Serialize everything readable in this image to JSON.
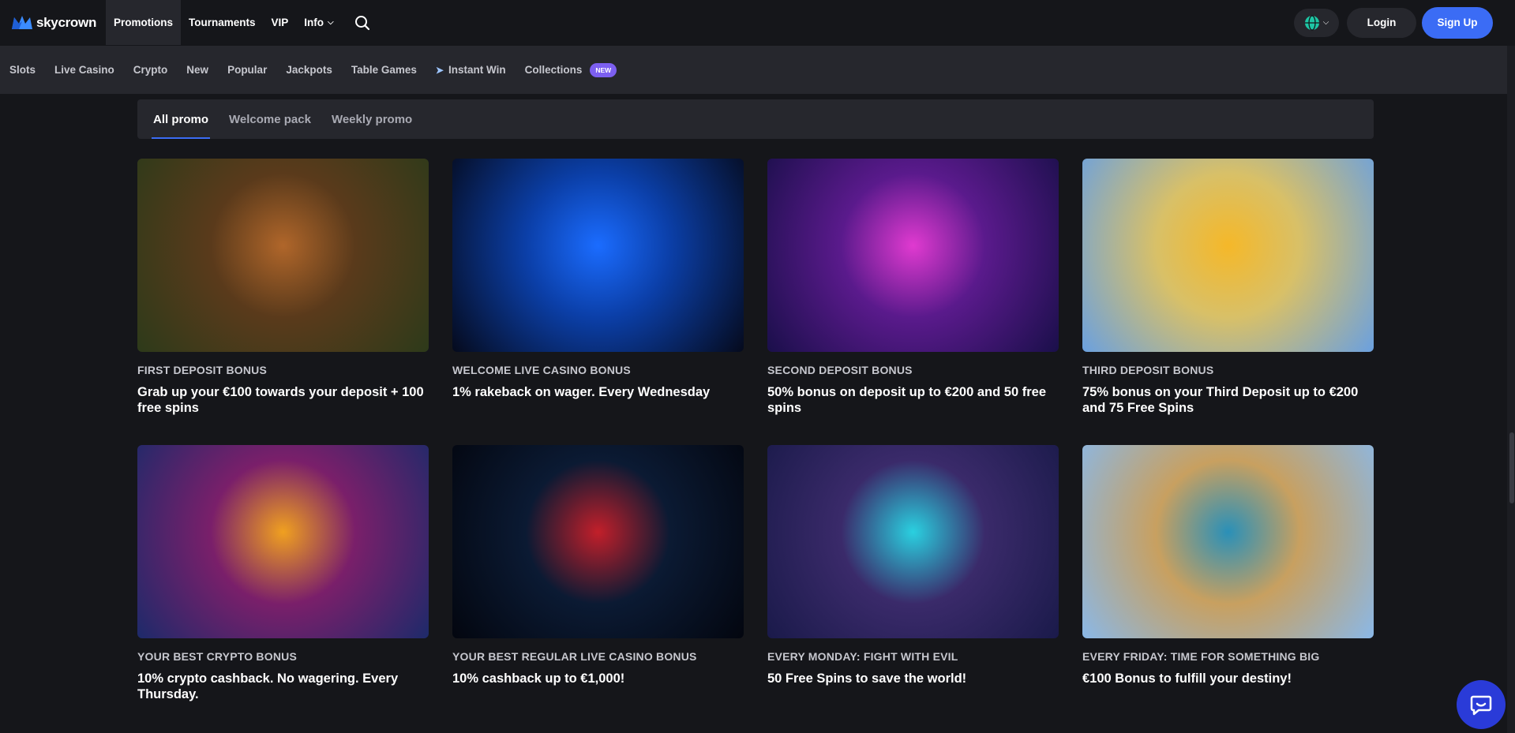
{
  "header": {
    "logo_text": "skycrown",
    "nav": [
      {
        "label": "Promotions",
        "active": true
      },
      {
        "label": "Tournaments"
      },
      {
        "label": "VIP"
      },
      {
        "label": "Info",
        "dropdown": true
      }
    ],
    "login_label": "Login",
    "signup_label": "Sign Up"
  },
  "categories": [
    {
      "label": "Slots"
    },
    {
      "label": "Live Casino"
    },
    {
      "label": "Crypto"
    },
    {
      "label": "New"
    },
    {
      "label": "Popular"
    },
    {
      "label": "Jackpots"
    },
    {
      "label": "Table Games"
    },
    {
      "label": "Instant Win",
      "icon": "rocket-icon"
    },
    {
      "label": "Collections",
      "badge": "NEW"
    }
  ],
  "tabs": [
    {
      "label": "All promo",
      "active": true
    },
    {
      "label": "Welcome pack"
    },
    {
      "label": "Weekly promo"
    }
  ],
  "promos": [
    {
      "caption": "FIRST DEPOSIT BONUS",
      "title": "Grab up your €100 towards your deposit + 100 free spins",
      "bg": [
        "#2d3a1a",
        "#5a3a1b",
        "#b0662a"
      ]
    },
    {
      "caption": "WELCOME LIVE CASINO BONUS",
      "title": "1% rakeback on wager. Every Wednesday",
      "bg": [
        "#050a1c",
        "#0b3fa8",
        "#1b6cff"
      ]
    },
    {
      "caption": "SECOND DEPOSIT BONUS",
      "title": "50% bonus on deposit up to €200 and 50 free spins",
      "bg": [
        "#1a0f4a",
        "#5a1a8c",
        "#e03ad0"
      ]
    },
    {
      "caption": "THIRD DEPOSIT BONUS",
      "title": "75% bonus on your Third Deposit up to €200 and 75 Free Spins",
      "bg": [
        "#6aa0e0",
        "#d8c068",
        "#f5b829"
      ]
    },
    {
      "caption": "YOUR BEST CRYPTO BONUS",
      "title": "10% crypto cashback. No wagering. Every Thursday.",
      "bg": [
        "#1d2a6a",
        "#7a1f6a",
        "#f0a020"
      ]
    },
    {
      "caption": "YOUR BEST REGULAR LIVE CASINO BONUS",
      "title": "10% cashback up to €1,000!",
      "bg": [
        "#03060f",
        "#0b1a33",
        "#c21f2a"
      ]
    },
    {
      "caption": "EVERY MONDAY: FIGHT WITH EVIL",
      "title": "50 Free Spins to save the world!",
      "bg": [
        "#1a1a4a",
        "#3a2a6a",
        "#2ad0e0"
      ]
    },
    {
      "caption": "EVERY FRIDAY: TIME FOR SOMETHING BIG",
      "title": "€100 Bonus to fulfill your destiny!",
      "bg": [
        "#8ab8e8",
        "#c8a060",
        "#2a90b8"
      ]
    }
  ]
}
